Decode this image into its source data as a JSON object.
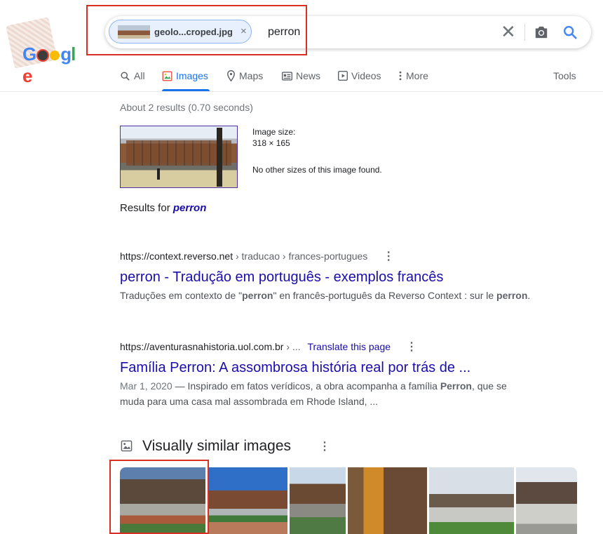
{
  "logo": {
    "text": "Google"
  },
  "search": {
    "chip_filename": "geolo...croped.jpg",
    "chip_close": "×",
    "query": "perron",
    "clear": "✕"
  },
  "tabs": [
    {
      "label": "All",
      "icon": "search-icon",
      "active": false
    },
    {
      "label": "Images",
      "icon": "image-icon",
      "active": true
    },
    {
      "label": "Maps",
      "icon": "map-pin-icon",
      "active": false
    },
    {
      "label": "News",
      "icon": "news-icon",
      "active": false
    },
    {
      "label": "Videos",
      "icon": "video-icon",
      "active": false
    },
    {
      "label": "More",
      "icon": "more-vert-icon",
      "active": false
    }
  ],
  "tools_label": "Tools",
  "stats": "About 2 results (0.70 seconds)",
  "image_info": {
    "size_label": "Image size:",
    "size_value": "318 × 165",
    "no_other": "No other sizes of this image found."
  },
  "results_for": {
    "prefix": "Results for ",
    "term": "perron"
  },
  "results": [
    {
      "domain": "https://context.reverso.net",
      "breadcrumb": " › traducao › frances-portugues",
      "translate": "",
      "title": "perron - Tradução em português - exemplos francês",
      "date": "",
      "snippet_parts": [
        "Traduções em contexto de \"",
        "perron",
        "\" en francês-português da Reverso Context : sur le ",
        "perron",
        "."
      ]
    },
    {
      "domain": "https://aventurasnahistoria.uol.com.br",
      "breadcrumb": " › ...",
      "translate": "Translate this page",
      "title": "Família Perron: A assombrosa história real por trás de ...",
      "date": "Mar 1, 2020",
      "snippet_parts": [
        " — Inspirado em fatos verídicos, a obra acompanha a família ",
        "Perron",
        ", que se muda para uma casa mal assombrada em Rhode Island, ..."
      ]
    }
  ],
  "similar": {
    "title": "Visually similar images",
    "thumbnail_count": 6
  },
  "colors": {
    "link": "#1a0dab",
    "accent": "#1a73e8",
    "highlight_box": "#d93025"
  }
}
